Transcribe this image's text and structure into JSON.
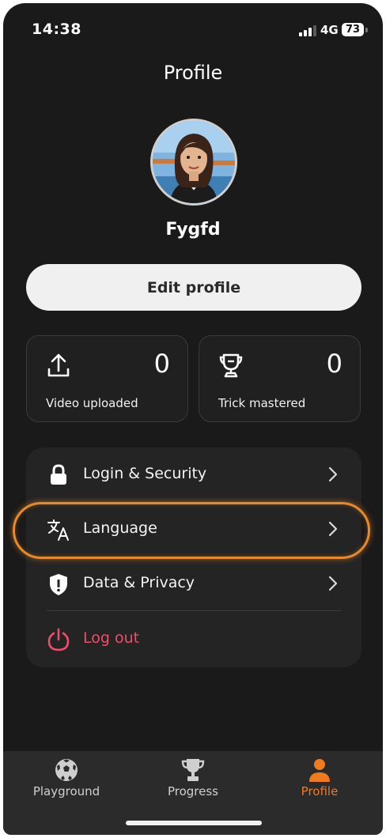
{
  "status_bar": {
    "time": "14:38",
    "network": "4G",
    "battery": "73"
  },
  "page_title": "Profile",
  "user": {
    "name": "Fygfd"
  },
  "edit_profile_label": "Edit profile",
  "stats": [
    {
      "label": "Video uploaded",
      "value": "0",
      "icon": "upload-icon"
    },
    {
      "label": "Trick mastered",
      "value": "0",
      "icon": "trophy-icon"
    }
  ],
  "menu": {
    "items": [
      {
        "label": "Login & Security",
        "icon": "lock-icon"
      },
      {
        "label": "Language",
        "icon": "translate-icon"
      },
      {
        "label": "Data & Privacy",
        "icon": "shield-icon"
      }
    ],
    "logout_label": "Log out"
  },
  "tabs": [
    {
      "label": "Playground",
      "icon": "soccer-ball-icon",
      "active": false
    },
    {
      "label": "Progress",
      "icon": "trophy-icon",
      "active": false
    },
    {
      "label": "Profile",
      "icon": "person-icon",
      "active": true
    }
  ],
  "colors": {
    "background": "#1a1a1a",
    "accent": "#f07a1e",
    "highlight": "#e8892c",
    "logout": "#ef4d6b"
  }
}
